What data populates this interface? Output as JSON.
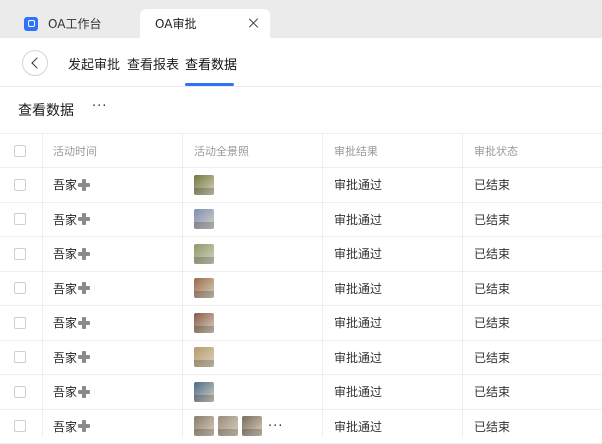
{
  "tabs": [
    {
      "label": "OA工作台",
      "active": false
    },
    {
      "label": "OA审批",
      "active": true
    }
  ],
  "nav": {
    "tabs": [
      {
        "label": "发起审批",
        "active": false
      },
      {
        "label": "查看报表",
        "active": false
      },
      {
        "label": "查看数据",
        "active": true
      }
    ]
  },
  "page": {
    "title": "查看数据",
    "more": "···"
  },
  "table": {
    "columns": [
      "活动时间",
      "活动全景照",
      "审批结果",
      "审批状态"
    ],
    "rows": [
      {
        "time": "吾家",
        "result": "审批通过",
        "status": "已结束",
        "photos": [
          "#6d7a3a"
        ]
      },
      {
        "time": "吾家",
        "result": "审批通过",
        "status": "已结束",
        "photos": [
          "#7b8fb5"
        ]
      },
      {
        "time": "吾家",
        "result": "审批通过",
        "status": "已结束",
        "photos": [
          "#8a9a6a"
        ]
      },
      {
        "time": "吾家",
        "result": "审批通过",
        "status": "已结束",
        "photos": [
          "#9a6a4a"
        ]
      },
      {
        "time": "吾家",
        "result": "审批通过",
        "status": "已结束",
        "photos": [
          "#8a5a4a"
        ]
      },
      {
        "time": "吾家",
        "result": "审批通过",
        "status": "已结束",
        "photos": [
          "#b89a6a"
        ]
      },
      {
        "time": "吾家",
        "result": "审批通过",
        "status": "已结束",
        "photos": [
          "#4a6a8a"
        ]
      },
      {
        "time": "吾家",
        "result": "审批通过",
        "status": "已结束",
        "photos": [
          "#8a7a6a",
          "#9a8a7a",
          "#7a6a5a"
        ],
        "more": "···"
      }
    ]
  },
  "colors": {
    "accent": "#2f73f7",
    "tabstrip": "#ebebeb"
  }
}
